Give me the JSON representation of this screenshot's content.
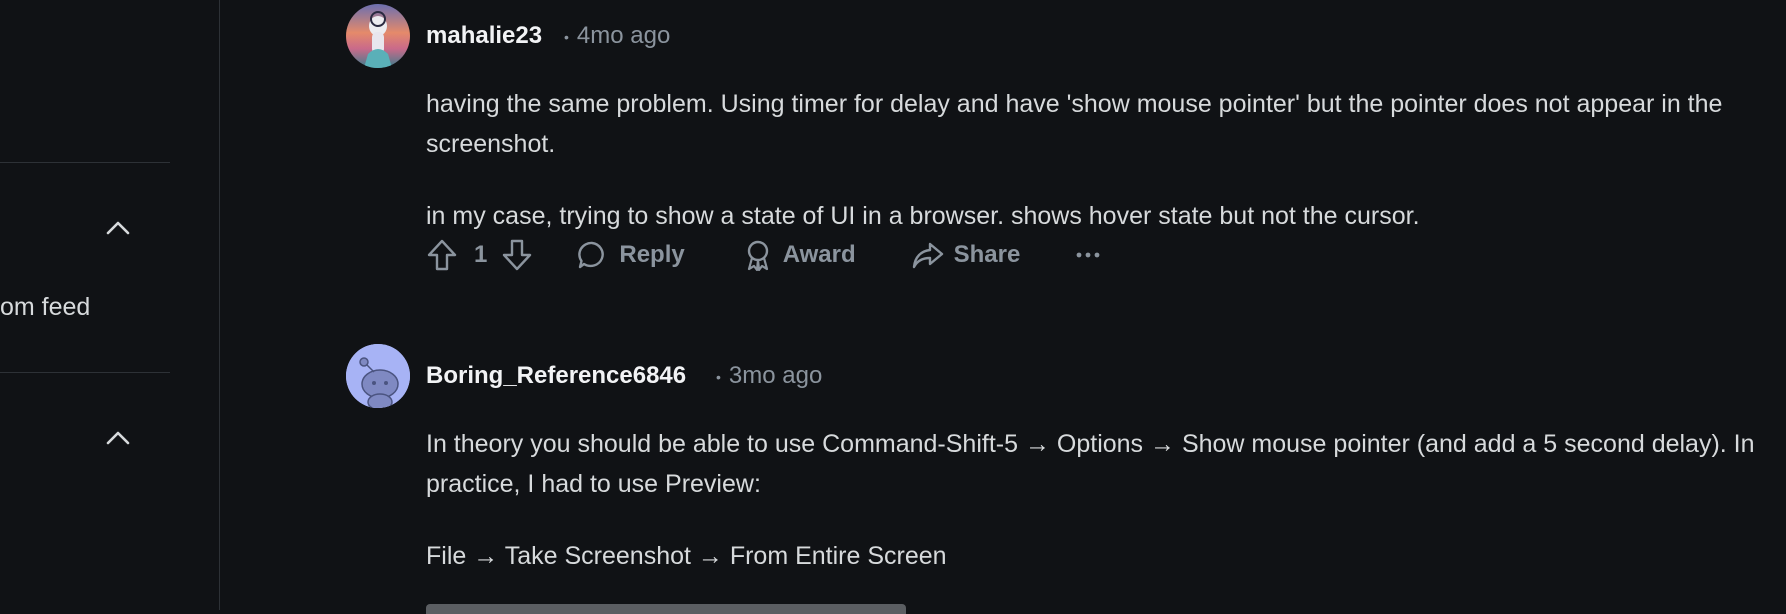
{
  "sidebar": {
    "partial_text": "om feed"
  },
  "comments": [
    {
      "author": "mahalie23",
      "age": "4mo ago",
      "paragraphs": [
        "having the same problem. Using timer for delay and have 'show mouse pointer' but the pointer does not appear in the screenshot.",
        "in my case, trying to show a state of UI in a browser. shows hover state but not the cursor."
      ],
      "score": "1",
      "actions": {
        "reply": "Reply",
        "award": "Award",
        "share": "Share"
      }
    },
    {
      "author": "Boring_Reference6846",
      "age": "3mo ago",
      "paragraphs": [
        "In theory you should be able to use Command-Shift-5 → Options → Show mouse pointer (and add a 5 second delay). In practice, I had to use Preview:",
        "File → Take Screenshot → From Entire Screen"
      ]
    }
  ],
  "colors": {
    "background": "#101215",
    "text": "#d7dadc",
    "muted": "#8b949e",
    "default_avatar": "#a7b3f5"
  },
  "icons": [
    "chevron-up-icon",
    "upvote-icon",
    "downvote-icon",
    "reply-bubble-icon",
    "award-icon",
    "share-icon",
    "more-icon"
  ]
}
